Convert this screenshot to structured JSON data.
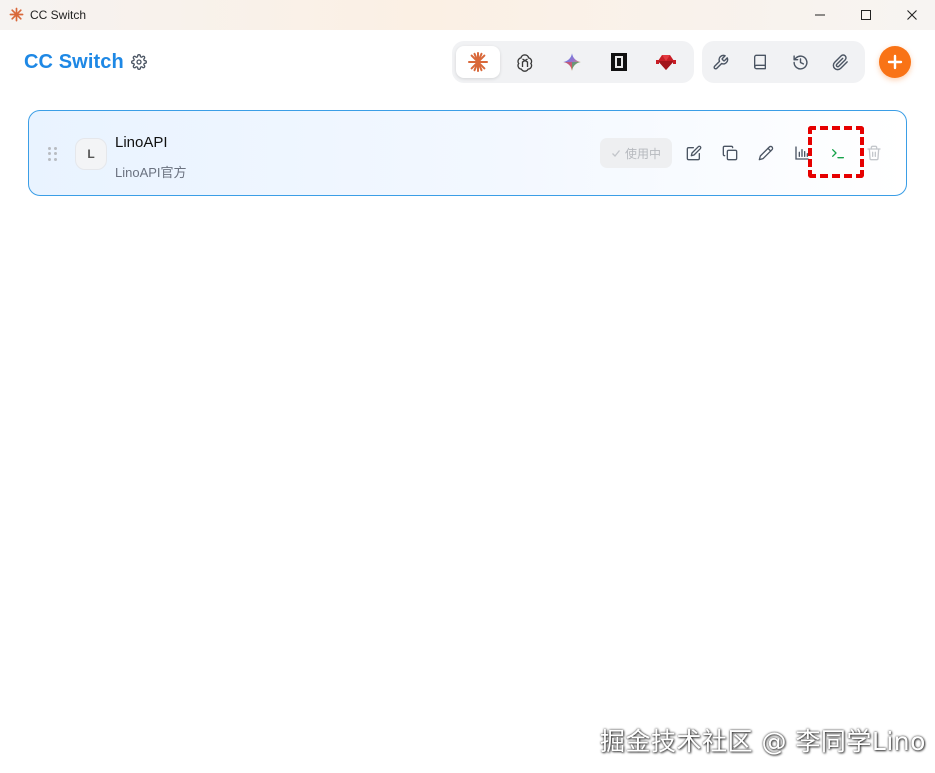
{
  "window": {
    "title": "CC Switch",
    "minimize_icon": "minimize-icon",
    "maximize_icon": "maximize-icon",
    "close_icon": "close-icon"
  },
  "header": {
    "brand": "CC Switch",
    "brand_color": "#1e88e5",
    "settings_icon": "gear-icon",
    "app_tabs": [
      {
        "icon": "claude-icon",
        "active": true
      },
      {
        "icon": "openai-icon",
        "active": false
      },
      {
        "icon": "gemini-icon",
        "active": false
      },
      {
        "icon": "terminal-app-icon",
        "active": false
      },
      {
        "icon": "ruby-icon",
        "active": false
      }
    ],
    "tools": [
      {
        "icon": "wrench-icon"
      },
      {
        "icon": "book-icon"
      },
      {
        "icon": "history-icon"
      },
      {
        "icon": "paperclip-icon"
      }
    ],
    "add_icon": "plus-icon",
    "add_color": "#f97316"
  },
  "providers": [
    {
      "avatar_letter": "L",
      "name": "LinoAPI",
      "description": "LinoAPI官方",
      "status_label": "使用中",
      "active": true,
      "actions": [
        {
          "icon": "edit-icon"
        },
        {
          "icon": "copy-icon"
        },
        {
          "icon": "pen-icon"
        },
        {
          "icon": "bar-chart-icon"
        },
        {
          "icon": "terminal-icon",
          "highlighted": true
        },
        {
          "icon": "trash-icon"
        }
      ]
    }
  ],
  "watermark": "掘金技术社区 @ 李同学Lino"
}
